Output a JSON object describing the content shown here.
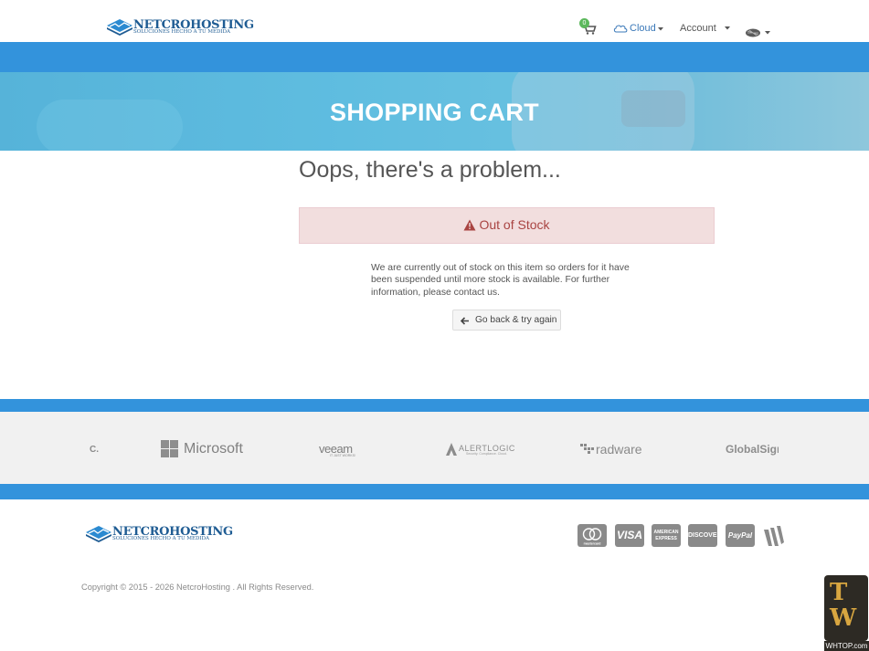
{
  "header": {
    "logo_name": "NETCROHOSTING",
    "logo_tagline": "SOLUCIONES HECHO A TU MEDIDA",
    "cart_icon": "shopping-cart-icon",
    "cart_count": "0",
    "nav": {
      "cloud_label": "Cloud",
      "cloud_icon": "cloud-icon",
      "account_label": "Account",
      "language_icon": "language-flag-icon"
    }
  },
  "hero": {
    "title": "SHOPPING CART"
  },
  "main": {
    "heading": "Oops, there's a problem...",
    "alert": {
      "icon": "warning-icon",
      "text": "Out of Stock",
      "color": "#a94442",
      "background": "#f2dede"
    },
    "description": "We are currently out of stock on this item so orders for it have been suspended until more stock is available. For further information, please contact us.",
    "back_button": {
      "icon": "arrow-left-icon",
      "label": "Go back & try again"
    }
  },
  "partners": {
    "items": [
      {
        "name": "partner-cut-off",
        "label": "C."
      },
      {
        "name": "microsoft",
        "label": "Microsoft"
      },
      {
        "name": "veeam",
        "label": "veeam",
        "sub": "IT JUST WORKS!"
      },
      {
        "name": "alertlogic",
        "label": "ALERTLOGIC",
        "sub": "Security. Compliance. Cloud."
      },
      {
        "name": "radware",
        "label": "radware"
      },
      {
        "name": "globalsign",
        "label": "GlobalSign"
      }
    ]
  },
  "footer": {
    "logo_name": "NETCROHOSTING",
    "logo_tagline": "SOLUCIONES HECHO A TU MEDIDA",
    "payments": {
      "mastercard": "mastercard",
      "visa": "VISA",
      "amex": "AMERICAN EXPRESS",
      "discover": "DISCOVER",
      "paypal": "PayPal",
      "other_icon": "w-payment-icon"
    },
    "copyright": "Copyright © 2015 - 2026 NetcroHosting . All Rights Reserved."
  },
  "watermark": {
    "url": "WHTOP.com"
  },
  "colors": {
    "brand_blue": "#3393dc",
    "hero_blue": "#5fbde0",
    "logo_blue": "#1f5c93",
    "badge_green": "#5cb85c"
  }
}
